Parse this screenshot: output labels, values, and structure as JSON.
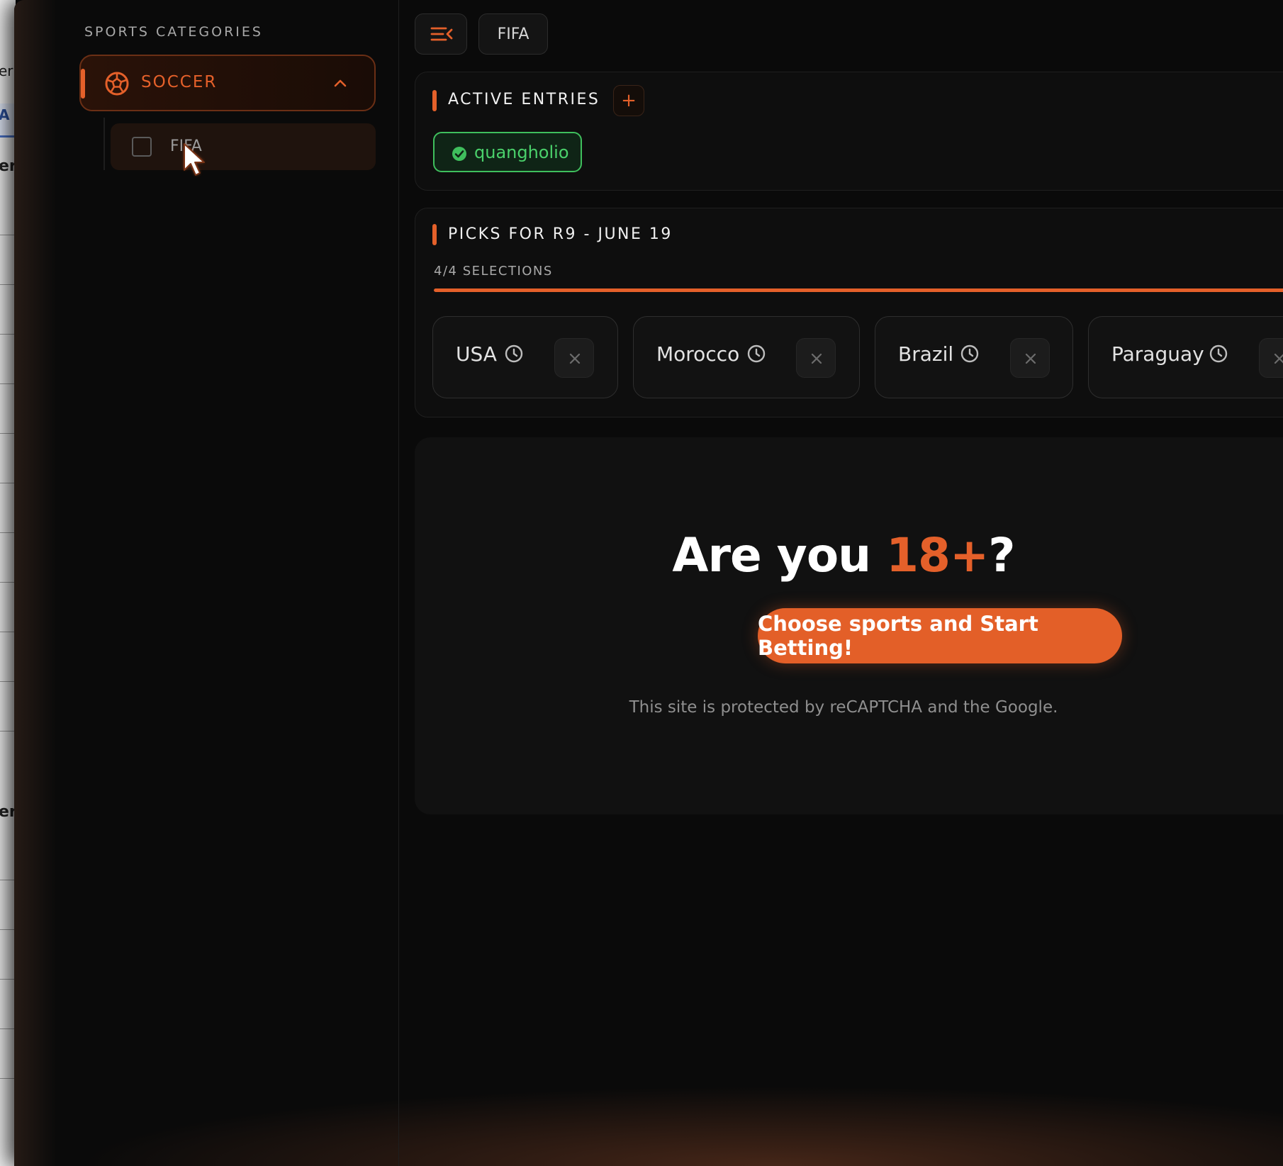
{
  "underlay": {
    "glyphs": [
      "er",
      "A",
      "er",
      "er"
    ]
  },
  "sidebar": {
    "title": "SPORTS CATEGORIES",
    "category": {
      "label": "SOCCER",
      "icon": "soccer-ball-icon",
      "expanded": true
    },
    "subitems": [
      {
        "label": "FIFA",
        "checked": false
      }
    ]
  },
  "toolbar": {
    "menu_icon": "menu-collapse-icon",
    "chip_label": "FIFA"
  },
  "active_entries": {
    "title": "ACTIVE ENTRIES",
    "add_label": "+",
    "entries": [
      {
        "name": "quangholio",
        "status": "verified"
      }
    ]
  },
  "picks": {
    "title": "PICKS FOR R9 - JUNE 19",
    "selections_label": "4/4 SELECTIONS",
    "progress_fraction": 1.0,
    "teams": [
      {
        "name": "USA"
      },
      {
        "name": "Morocco"
      },
      {
        "name": "Brazil"
      },
      {
        "name": "Paraguay"
      }
    ]
  },
  "hero": {
    "title_prefix": "Are you ",
    "title_accent": "18+",
    "title_suffix": "?",
    "cta_label": "Choose sports and Start Betting!",
    "legal_text": "This site is protected by reCAPTCHA and the Google."
  },
  "colors": {
    "accent": "#e4602a",
    "success": "#4ad16b",
    "background": "#0a0a0a"
  }
}
